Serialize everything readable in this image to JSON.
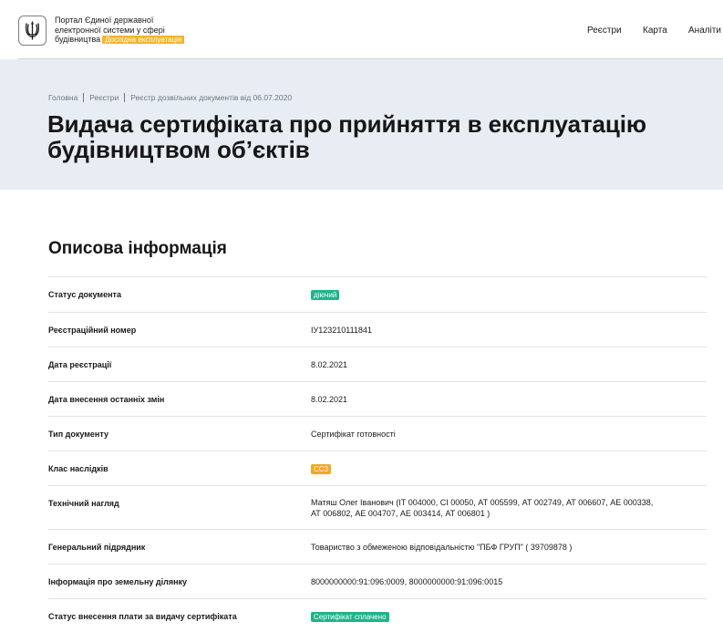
{
  "header": {
    "portal_name_lines": [
      "Портал Єдиної державної",
      "електронної системи у сфері",
      "будівництва"
    ],
    "beta_badge": "Дослідна експлуатація",
    "nav": [
      "Реєстри",
      "Карта",
      "Аналіти"
    ]
  },
  "breadcrumb": [
    "Головна",
    "Реєстри",
    "Реєстр дозвільних документів від 06.07.2020"
  ],
  "page_title_lines": [
    "Видача сертифіката про прийняття в експлуатацію",
    "будівництвом об’єктів"
  ],
  "section_title": "Описова інформація",
  "fields": [
    {
      "label": "Статус документа",
      "value": "діючий",
      "badge": "green"
    },
    {
      "label": "Реєстраційний номер",
      "value": "ІУ123210111841"
    },
    {
      "label": "Дата реєстрації",
      "value": "8.02.2021"
    },
    {
      "label": "Дата внесення останніх змін",
      "value": "8.02.2021"
    },
    {
      "label": "Тип документу",
      "value": "Сертифікат готовності"
    },
    {
      "label": "Клас наслідків",
      "value": "СС3",
      "badge": "orange"
    },
    {
      "label": "Технічний нагляд",
      "value_lines": [
        "Матяш Олег Іванович (ІТ 004000, СІ 00050, АТ 005599, АТ 002749, АТ 006607, АЕ 000338,",
        "АТ 006802, АЕ 004707, АЕ 003414, АТ 006801 )"
      ]
    },
    {
      "label": "Генеральний підрядник",
      "value": "Товариство з обмеженою відповідальністю \"ПБФ ГРУП\" ( 39709878 )"
    },
    {
      "label": "Інформація про земельну ділянку",
      "value": "8000000000:91:096:0009, 8000000000:91:096:0015"
    },
    {
      "label": "Статус внесення плати за видачу сертифіката",
      "value": "Сертифікат сплачено",
      "badge": "green"
    }
  ],
  "colors": {
    "hero_bg": "#e7edf3",
    "badge_green": "#1db58a",
    "badge_orange": "#f2a91d",
    "beta_badge": "#f2b42d"
  }
}
